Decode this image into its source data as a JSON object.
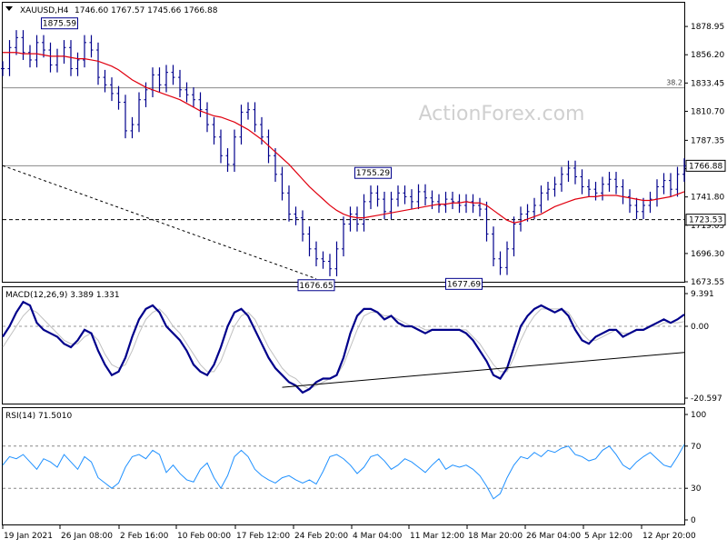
{
  "chart_data": [
    {
      "type": "line",
      "panel": "price",
      "title": "XAUUSD,H4",
      "ohlc_text": "1746.60 1767.57 1745.66 1766.88",
      "ylim": [
        1673.55,
        1890
      ],
      "y_ticks": [
        "1878.95",
        "1856.20",
        "1833.45",
        "1810.70",
        "1787.35",
        "1764.60",
        "1741.80",
        "1719.05",
        "1696.30",
        "1673.55"
      ],
      "x": [
        0,
        3,
        6,
        9,
        12,
        15,
        18,
        21,
        24,
        27,
        30,
        33,
        36,
        39,
        42,
        45,
        48,
        51,
        54,
        57,
        60,
        63,
        66,
        69,
        72,
        75,
        78,
        81,
        84,
        87,
        90,
        93,
        96,
        99,
        102,
        105,
        108,
        111,
        114,
        117,
        120,
        123,
        126,
        129,
        132,
        135,
        138,
        141,
        144,
        147,
        150,
        153,
        156,
        159,
        162,
        165,
        168,
        171,
        174,
        177,
        180,
        183,
        186,
        189,
        192,
        195,
        198,
        201,
        204,
        207,
        210,
        213,
        216,
        219,
        222,
        225,
        228,
        231,
        234,
        237,
        240,
        243,
        246,
        249,
        252,
        255,
        258,
        261,
        264,
        267,
        270,
        273,
        276,
        279,
        282,
        285,
        288,
        291,
        294,
        297,
        300
      ],
      "series": [
        {
          "role": "price-bars",
          "color": "#00008b",
          "values": [
            1845,
            1862,
            1870,
            1858,
            1852,
            1866,
            1860,
            1848,
            1855,
            1862,
            1845,
            1852,
            1866,
            1860,
            1838,
            1832,
            1825,
            1818,
            1795,
            1800,
            1820,
            1828,
            1840,
            1832,
            1842,
            1838,
            1828,
            1824,
            1820,
            1812,
            1800,
            1790,
            1775,
            1768,
            1790,
            1810,
            1812,
            1800,
            1790,
            1775,
            1760,
            1745,
            1728,
            1725,
            1712,
            1700,
            1692,
            1690,
            1684,
            1700,
            1720,
            1728,
            1720,
            1738,
            1745,
            1740,
            1730,
            1740,
            1745,
            1742,
            1738,
            1746,
            1741,
            1738,
            1735,
            1740,
            1738,
            1735,
            1738,
            1735,
            1732,
            1712,
            1692,
            1685,
            1700,
            1720,
            1728,
            1730,
            1735,
            1745,
            1748,
            1752,
            1760,
            1765,
            1758,
            1750,
            1748,
            1745,
            1752,
            1756,
            1750,
            1742,
            1735,
            1730,
            1735,
            1740,
            1750,
            1755,
            1748,
            1760,
            1766.88
          ]
        },
        {
          "role": "moving-average",
          "color": "#e0000f",
          "values": [
            1858,
            1858,
            1858,
            1857,
            1857,
            1857,
            1856,
            1855,
            1855,
            1855,
            1854,
            1853,
            1853,
            1852,
            1851,
            1849,
            1847,
            1844,
            1840,
            1836,
            1833,
            1830,
            1828,
            1826,
            1824,
            1822,
            1820,
            1817,
            1814,
            1811,
            1809,
            1807,
            1806,
            1804,
            1802,
            1799,
            1796,
            1792,
            1788,
            1783,
            1778,
            1773,
            1768,
            1762,
            1756,
            1750,
            1745,
            1740,
            1735,
            1731,
            1728,
            1726,
            1725,
            1725,
            1726,
            1727,
            1728,
            1729,
            1730,
            1731,
            1732,
            1733,
            1734,
            1735,
            1736,
            1736,
            1737,
            1737,
            1738,
            1737,
            1737,
            1735,
            1731,
            1727,
            1723,
            1721,
            1722,
            1724,
            1726,
            1728,
            1731,
            1734,
            1736,
            1738,
            1740,
            1741,
            1742,
            1742,
            1743,
            1743,
            1743,
            1742,
            1741,
            1740,
            1739,
            1739,
            1740,
            1741,
            1742,
            1744,
            1746
          ]
        }
      ],
      "horizontal_lines": [
        {
          "value": 1829.6,
          "label": "38.2",
          "style": "solid"
        },
        {
          "value": 1766.88,
          "label": "1766.88",
          "style": "solid",
          "badge": true
        },
        {
          "value": 1723.53,
          "label": "1723.53",
          "style": "dashed",
          "badge": true
        }
      ],
      "trendline": {
        "x": [
          0,
          138
        ],
        "y": [
          1767,
          1676
        ]
      },
      "annotations": [
        {
          "x": 25,
          "y": 1875.59,
          "text": "1875.59"
        },
        {
          "x": 163,
          "y": 1755.29,
          "text": "1755.29"
        },
        {
          "x": 138,
          "y": 1676.65,
          "text": "1676.65"
        },
        {
          "x": 203,
          "y": 1677.69,
          "text": "1677.69"
        }
      ],
      "watermark": "ActionForex.com"
    },
    {
      "type": "line",
      "panel": "macd",
      "title": "MACD(12,26,9) 3.389 1.331",
      "ylim": [
        -20.597,
        9.391
      ],
      "y_ticks": [
        "9.391",
        "0.00",
        "-20.597"
      ],
      "x": [
        0,
        3,
        6,
        9,
        12,
        15,
        18,
        21,
        24,
        27,
        30,
        33,
        36,
        39,
        42,
        45,
        48,
        51,
        54,
        57,
        60,
        63,
        66,
        69,
        72,
        75,
        78,
        81,
        84,
        87,
        90,
        93,
        96,
        99,
        102,
        105,
        108,
        111,
        114,
        117,
        120,
        123,
        126,
        129,
        132,
        135,
        138,
        141,
        144,
        147,
        150,
        153,
        156,
        159,
        162,
        165,
        168,
        171,
        174,
        177,
        180,
        183,
        186,
        189,
        192,
        195,
        198,
        201,
        204,
        207,
        210,
        213,
        216,
        219,
        222,
        225,
        228,
        231,
        234,
        237,
        240,
        243,
        246,
        249,
        252,
        255,
        258,
        261,
        264,
        267,
        270,
        273,
        276,
        279,
        282,
        285,
        288,
        291,
        294,
        297,
        300
      ],
      "series": [
        {
          "role": "macd",
          "color": "#00008b",
          "values": [
            -3,
            0,
            4,
            7,
            6,
            1,
            -1,
            -2,
            -3,
            -5,
            -6,
            -4,
            -1,
            -2,
            -7,
            -11,
            -14,
            -13,
            -9,
            -3,
            2,
            5,
            6,
            4,
            0,
            -2,
            -4,
            -7,
            -11,
            -13,
            -14,
            -11,
            -6,
            0,
            4,
            5,
            3,
            -1,
            -5,
            -9,
            -12,
            -14,
            -16,
            -17,
            -19,
            -18,
            -16,
            -15,
            -15,
            -14,
            -9,
            -2,
            3,
            5,
            5,
            4,
            2,
            3,
            1,
            0,
            0,
            -1,
            -2,
            -1,
            -1,
            -1,
            -1,
            -1,
            -2,
            -4,
            -7,
            -10,
            -14,
            -15,
            -12,
            -6,
            0,
            3,
            5,
            6,
            5,
            4,
            5,
            3,
            -1,
            -4,
            -5,
            -3,
            -2,
            -1,
            -1,
            -3,
            -2,
            -1,
            -1,
            0,
            1,
            2,
            1,
            2,
            3.389
          ]
        },
        {
          "role": "signal",
          "color": "#c0c0c0",
          "values": [
            -6,
            -3,
            0,
            3,
            5,
            4,
            2,
            0,
            -2,
            -4,
            -5,
            -5,
            -3,
            -2,
            -4,
            -8,
            -11,
            -12,
            -11,
            -7,
            -2,
            2,
            4,
            5,
            3,
            0,
            -2,
            -5,
            -8,
            -11,
            -13,
            -13,
            -10,
            -5,
            0,
            3,
            4,
            2,
            -2,
            -6,
            -9,
            -12,
            -14,
            -15,
            -17,
            -18,
            -17,
            -16,
            -15,
            -14,
            -11,
            -6,
            -1,
            3,
            4,
            4,
            3,
            3,
            2,
            1,
            0,
            0,
            -1,
            -1,
            -1,
            -1,
            -1,
            -1,
            -1,
            -3,
            -5,
            -8,
            -11,
            -13,
            -13,
            -9,
            -4,
            0,
            3,
            5,
            5,
            5,
            5,
            4,
            1,
            -2,
            -4,
            -4,
            -3,
            -2,
            -1,
            -2,
            -2,
            -1,
            -1,
            0,
            0,
            1,
            1,
            1,
            1.331
          ]
        }
      ],
      "trendline": {
        "x": [
          123,
          300
        ],
        "y": [
          -17.5,
          -7.5
        ]
      }
    },
    {
      "type": "line",
      "panel": "rsi",
      "title": "RSI(14) 71.5010",
      "ylim": [
        0,
        100
      ],
      "y_ticks": [
        "100",
        "70",
        "30",
        "0"
      ],
      "levels": [
        70,
        30
      ],
      "x": [
        0,
        3,
        6,
        9,
        12,
        15,
        18,
        21,
        24,
        27,
        30,
        33,
        36,
        39,
        42,
        45,
        48,
        51,
        54,
        57,
        60,
        63,
        66,
        69,
        72,
        75,
        78,
        81,
        84,
        87,
        90,
        93,
        96,
        99,
        102,
        105,
        108,
        111,
        114,
        117,
        120,
        123,
        126,
        129,
        132,
        135,
        138,
        141,
        144,
        147,
        150,
        153,
        156,
        159,
        162,
        165,
        168,
        171,
        174,
        177,
        180,
        183,
        186,
        189,
        192,
        195,
        198,
        201,
        204,
        207,
        210,
        213,
        216,
        219,
        222,
        225,
        228,
        231,
        234,
        237,
        240,
        243,
        246,
        249,
        252,
        255,
        258,
        261,
        264,
        267,
        270,
        273,
        276,
        279,
        282,
        285,
        288,
        291,
        294,
        297,
        300
      ],
      "series": [
        {
          "role": "rsi",
          "color": "#1e90ff",
          "values": [
            52,
            60,
            58,
            62,
            55,
            48,
            58,
            55,
            50,
            62,
            55,
            48,
            60,
            55,
            40,
            35,
            30,
            35,
            50,
            60,
            62,
            58,
            66,
            62,
            45,
            52,
            44,
            38,
            36,
            48,
            54,
            40,
            30,
            42,
            60,
            66,
            60,
            48,
            42,
            38,
            35,
            40,
            42,
            38,
            35,
            38,
            34,
            46,
            60,
            62,
            58,
            52,
            44,
            50,
            60,
            62,
            56,
            48,
            52,
            58,
            55,
            50,
            45,
            52,
            58,
            48,
            52,
            50,
            52,
            48,
            42,
            32,
            20,
            25,
            40,
            52,
            60,
            58,
            64,
            60,
            66,
            64,
            68,
            70,
            62,
            60,
            56,
            58,
            66,
            70,
            62,
            52,
            48,
            55,
            60,
            64,
            58,
            52,
            50,
            60,
            71.501
          ]
        }
      ]
    }
  ],
  "x_axis_labels": [
    "19 Jan 2021",
    "26 Jan 08:00",
    "2 Feb 16:00",
    "10 Feb 00:00",
    "17 Feb 12:00",
    "24 Feb 20:00",
    "4 Mar 04:00",
    "11 Mar 12:00",
    "18 Mar 20:00",
    "26 Mar 04:00",
    "5 Apr 12:00",
    "12 Apr 20:00"
  ]
}
